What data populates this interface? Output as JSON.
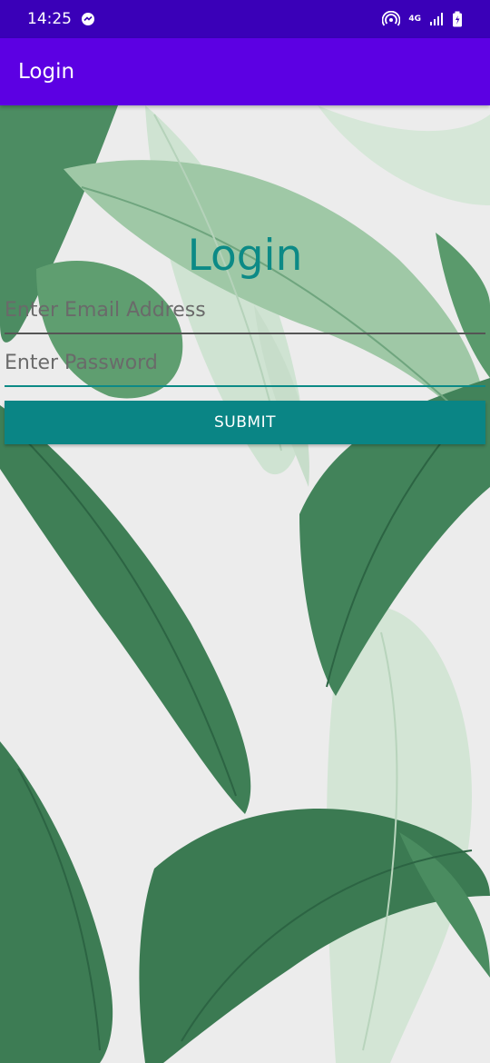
{
  "status_bar": {
    "time": "14:25",
    "network_label": "4G",
    "icons": [
      "messenger-icon",
      "hotspot-icon",
      "signal-icon",
      "battery-icon"
    ]
  },
  "app_bar": {
    "title": "Login"
  },
  "form": {
    "heading": "Login",
    "email_placeholder": "Enter Email Address",
    "password_placeholder": "Enter Password",
    "submit_label": "SUBMIT"
  },
  "colors": {
    "status_bar": "#3a00b8",
    "app_bar": "#5c00e3",
    "accent": "#0a8585",
    "heading": "#0c8a86"
  }
}
